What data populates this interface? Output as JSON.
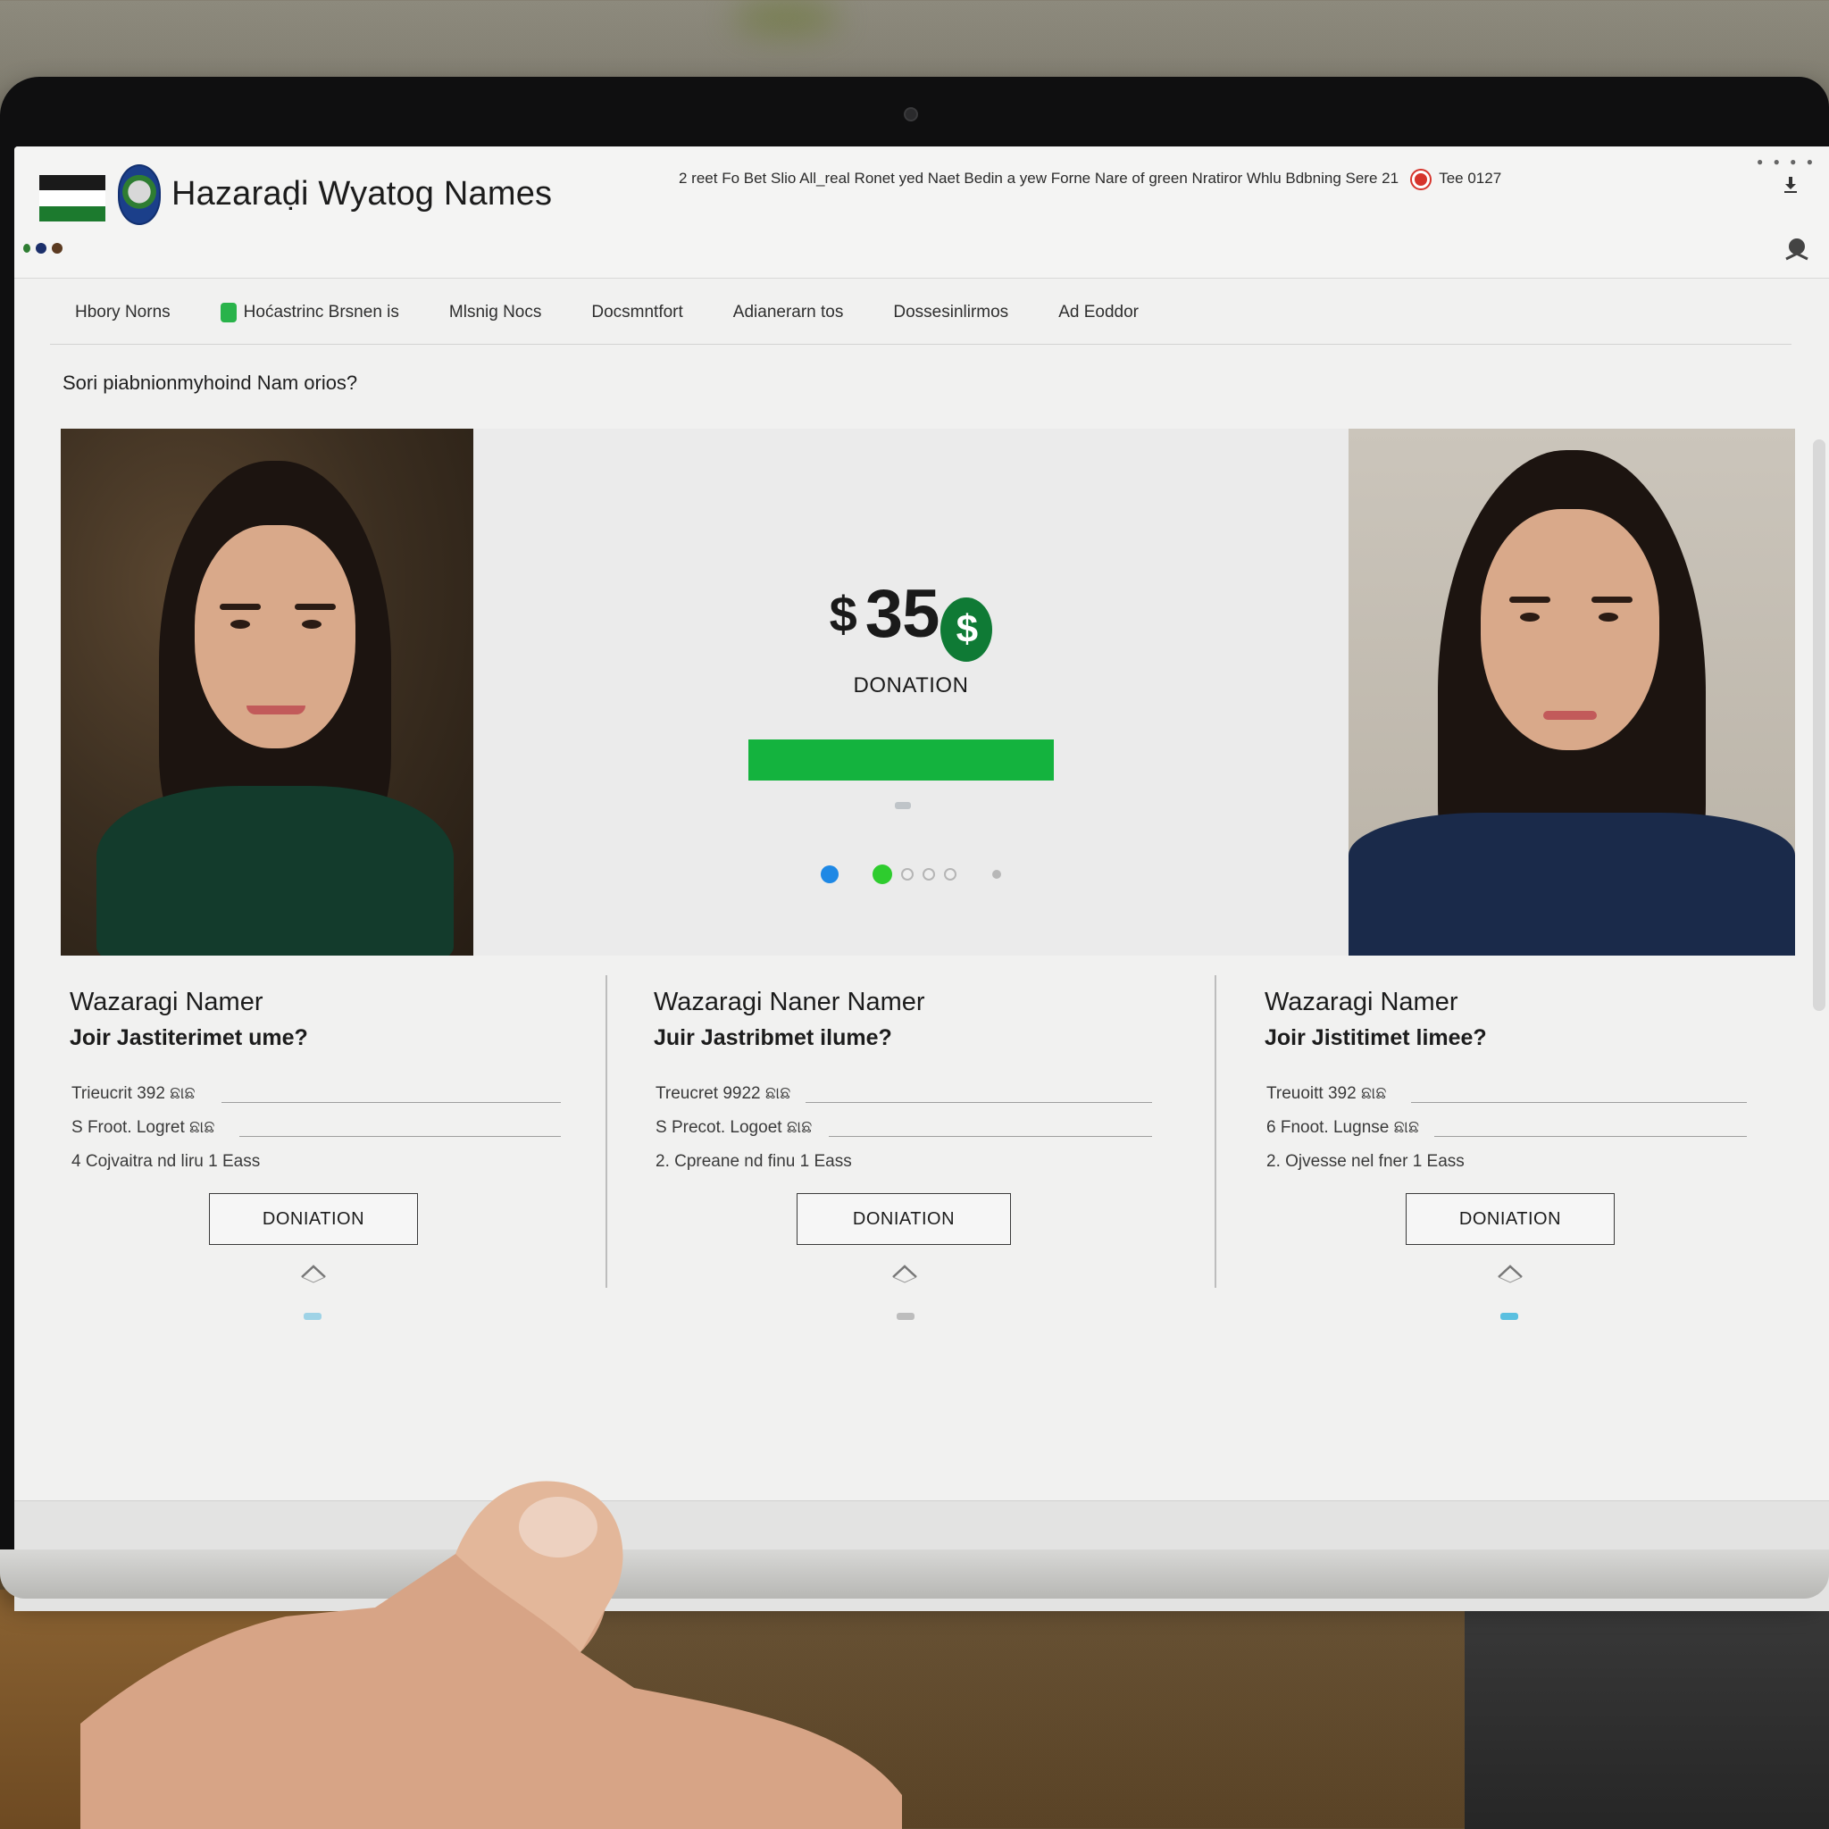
{
  "header": {
    "site_title": "Hazaraḍi Wyatog Names",
    "top_links": "2 reet  Fo Bet Slio All_real Ronet yed Naet Bedin a yew  Forne Nare of green Nratiror Whlu Bdbning Sere 21",
    "top_right_text": "Tee 0127"
  },
  "nav": {
    "items": [
      {
        "label": "Hbory Norns"
      },
      {
        "label": "Hoćastrinc Brsnen is"
      },
      {
        "label": "Mlsnig Nocs"
      },
      {
        "label": "Docsmntfort"
      },
      {
        "label": "Adianerarn tos"
      },
      {
        "label": "Dossesinlirmos"
      },
      {
        "label": "Ad Eoddor"
      }
    ]
  },
  "question": "Sori piabnionmyhoind Nam orios?",
  "carousel": {
    "amount": "35",
    "currency_symbol": "$",
    "coin_symbol": "$",
    "label": "DONATION",
    "progress_fraction": 1.0,
    "slide_count": 6,
    "active_slide": 2
  },
  "cards": [
    {
      "title": "Wazaragi Namer",
      "subtitle": "Joir Jastiterimet ume?",
      "lines": [
        "Trieucrit 392 ଛାଛ",
        "S Froot. Logret ଛାଛ",
        "4 Cojvaitra nd liru 1 Eass"
      ],
      "button": "DONIATION"
    },
    {
      "title": "Wazaragi Naner Namer",
      "subtitle": "Juir Jastribmet ilume?",
      "lines": [
        "Treucret 9922 ଛାଛ",
        "S Precot. Logoet ଛାଛ",
        "2. Cpreane nd finu 1 Eass"
      ],
      "button": "DONIATION"
    },
    {
      "title": "Wazaragi Namer",
      "subtitle": "Joir Jistitimet limee?",
      "lines": [
        "Treuoitt 392 ଛାଛ",
        "6 Fnoot. Lugnse ଛାଛ",
        "2. Ojvesse nel fner 1 Eass"
      ],
      "button": "DONIATION"
    }
  ],
  "colors": {
    "accent_green": "#14b33e",
    "coin_green": "#0f7a35",
    "dot_blue": "#1e88e5",
    "alert_red": "#d6342c"
  },
  "icons": {
    "flag": "flag-icon",
    "emblem": "emblem-icon",
    "download": "download-icon",
    "pin": "pin-icon",
    "coin": "coin-dollar-icon",
    "chevron": "chevron-up-icon"
  }
}
